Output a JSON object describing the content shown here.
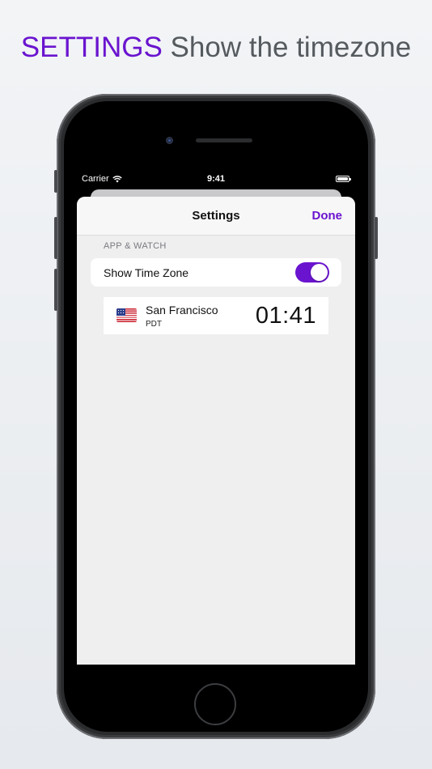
{
  "headline": {
    "accent": "SETTINGS",
    "rest": "Show the timezone"
  },
  "status_bar": {
    "carrier": "Carrier",
    "time": "9:41"
  },
  "navbar": {
    "title": "Settings",
    "done_label": "Done"
  },
  "section": {
    "header": "APP & WATCH",
    "toggle": {
      "label": "Show Time Zone",
      "on": true
    }
  },
  "timezone": {
    "city": "San Francisco",
    "abbreviation": "PDT",
    "time": "01:41",
    "flag_icon": "us-flag-icon"
  },
  "colors": {
    "accent": "#6a14cf",
    "headline_gray": "#555a5f",
    "sheet_bg": "#efeff0"
  }
}
